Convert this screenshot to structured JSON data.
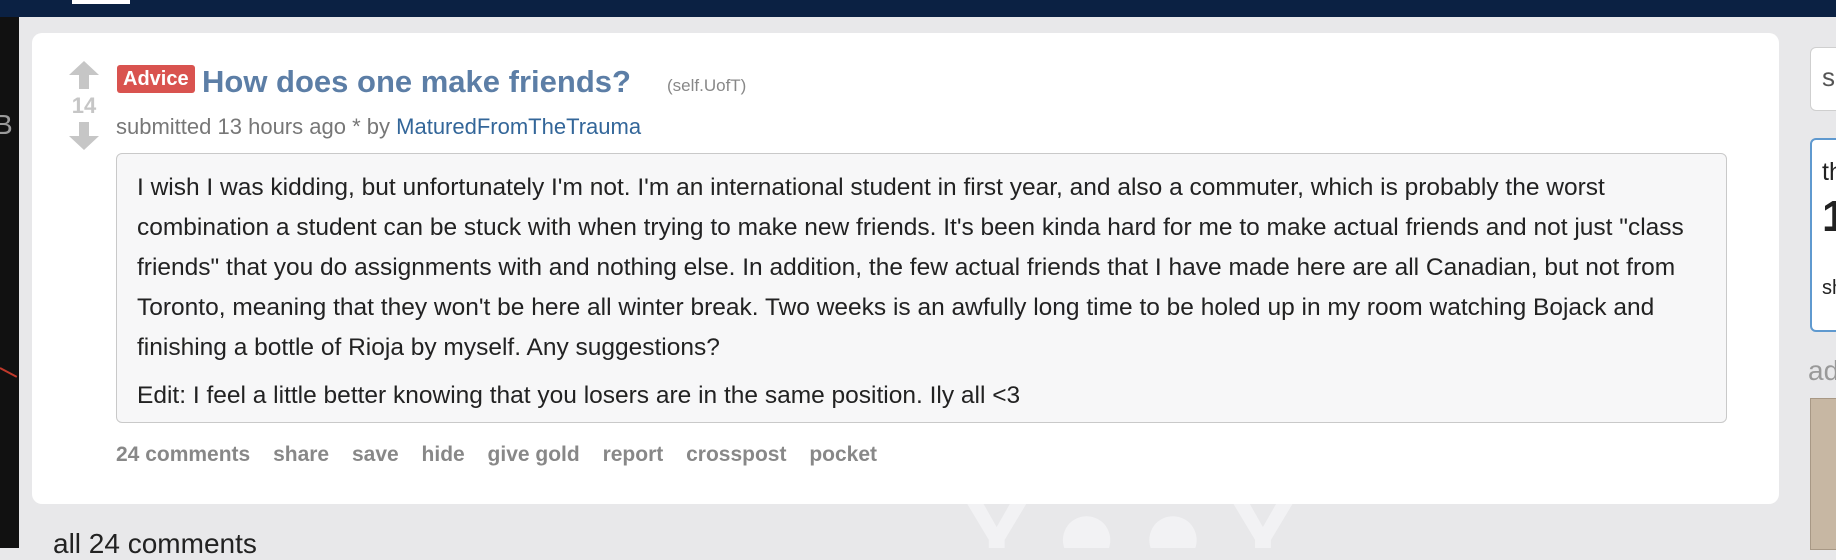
{
  "post": {
    "score": "14",
    "flair": "Advice",
    "title": "How does one make friends?",
    "domain": "(self.UofT)",
    "submitted_prefix": "submitted",
    "time_ago": "13 hours ago",
    "edited_mark": "*",
    "by": "by",
    "author": "MaturedFromTheTrauma",
    "body": [
      "I wish I was kidding, but unfortunately I'm not. I'm an international student in first year, and also a commuter, which is probably the worst combination a student can be stuck with when trying to make new friends. It's been kinda hard for me to make actual friends and not just \"class friends\" that you do assignments with and nothing else. In addition, the few actual friends that I have made here are all Canadian, but not from Toronto, meaning that they won't be here all winter break. Two weeks is an awfully long time to be holed up in my room watching Bojack and finishing a bottle of Rioja by myself. Any suggestions?",
      "Edit: I feel a little better knowing that you losers are in the same position. Ily all <3"
    ],
    "buttons": [
      "24 comments",
      "share",
      "save",
      "hide",
      "give gold",
      "report",
      "crosspost",
      "pocket"
    ]
  },
  "comments_heading": "all 24 comments",
  "sidebar": {
    "search_partial": "s",
    "box_line1": "th",
    "box_line2": "1",
    "box_line3": "sh",
    "ad_label_partial": "ad"
  },
  "left_strip_partial": "B",
  "colors": {
    "topbar": "#0b2143",
    "flair": "#d9534f",
    "title": "#5c7ea6",
    "author": "#336699",
    "sidebar_border": "#5f99cf"
  },
  "icons": [
    "upvote-arrow-icon",
    "downvote-arrow-icon"
  ]
}
